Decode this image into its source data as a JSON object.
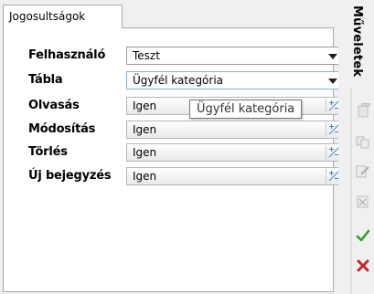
{
  "tab": {
    "label": "Jogosultságok"
  },
  "form": {
    "rows": [
      {
        "label": "Felhasználó",
        "value": "Teszt",
        "kind": "combo"
      },
      {
        "label": "Tábla",
        "value": "Ügyfél kategória",
        "kind": "combo"
      },
      {
        "label": "Olvasás",
        "value": "Igen",
        "kind": "toggle"
      },
      {
        "label": "Módosítás",
        "value": "Igen",
        "kind": "toggle"
      },
      {
        "label": "Törlés",
        "value": "Igen",
        "kind": "toggle"
      },
      {
        "label": "Új bejegyzés",
        "value": "Igen",
        "kind": "toggle"
      }
    ]
  },
  "tooltip": {
    "text": "Ügyfél kategória"
  },
  "sidebar": {
    "title": "Műveletek",
    "tools": [
      "new-record-icon",
      "copy-icon",
      "edit-icon",
      "delete-icon",
      "confirm-icon",
      "cancel-icon"
    ]
  },
  "colors": {
    "confirm": "#2ca02c",
    "cancel": "#c62828",
    "focus_border": "#7eb4ea"
  }
}
